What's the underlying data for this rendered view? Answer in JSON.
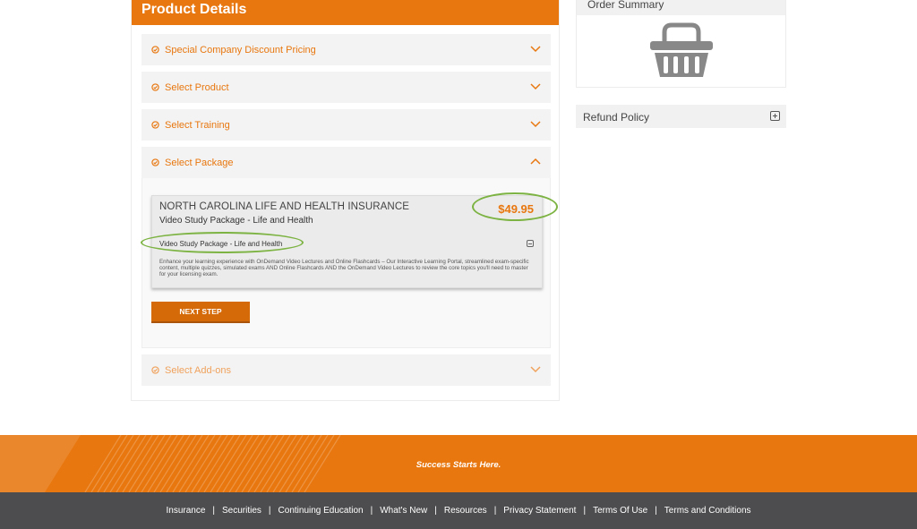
{
  "panel": {
    "title": "Product Details"
  },
  "accordion": [
    {
      "label": "Special Company Discount Pricing",
      "expanded": false
    },
    {
      "label": "Select Product",
      "expanded": false
    },
    {
      "label": "Select Training",
      "expanded": false
    },
    {
      "label": "Select Package",
      "expanded": true
    },
    {
      "label": "Select Add-ons",
      "expanded": false
    }
  ],
  "package": {
    "title": "NORTH CAROLINA LIFE AND HEALTH INSURANCE",
    "subtitle": "Video Study Package - Life and Health",
    "price": "$49.95",
    "option_label": "Video Study Package - Life and Health",
    "description": "Enhance your learning experience with OnDemand Video Lectures and Online Flashcards – Our Interactive Learning Portal, streamlined exam-specific content, multiple quizzes, simulated exams AND Online Flashcards AND the OnDemand Video Lectures to review the core topics you'll need to master for your licensing exam."
  },
  "next_button": "NEXT STEP",
  "order_summary": {
    "title": "Order Summary",
    "icon": "shopping-basket-icon"
  },
  "refund": {
    "label": "Refund Policy",
    "icon": "plus-square-icon"
  },
  "footer": {
    "tagline": "Success Starts Here.",
    "links": [
      "Insurance",
      "Securities",
      "Continuing Education",
      "What's New",
      "Resources",
      "Privacy Statement",
      "Terms Of Use",
      "Terms and Conditions"
    ]
  },
  "colors": {
    "accent": "#e8770f",
    "button": "#d56a08",
    "highlight": "#7cb342",
    "footer_dark": "#4d4d4f"
  }
}
